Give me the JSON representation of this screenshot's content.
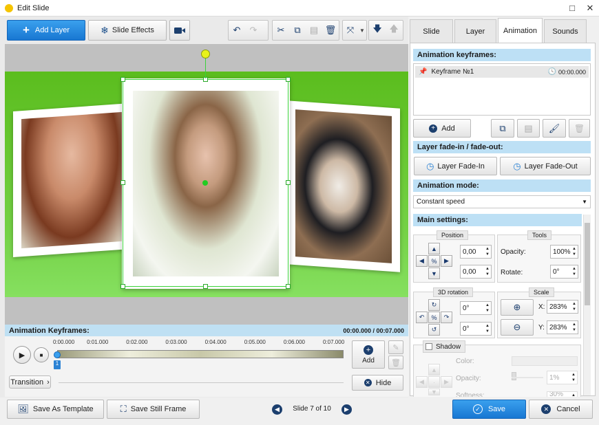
{
  "window": {
    "title": "Edit Slide",
    "minimize_icon": "□",
    "close_icon": "✕"
  },
  "toolbar": {
    "add_layer": "Add Layer",
    "slide_effects": "Slide Effects"
  },
  "timeline": {
    "title": "Animation Keyframes:",
    "time": "00:00.000 / 00:07.000",
    "ticks": [
      "0:00.000",
      "0:01.000",
      "0:02.000",
      "0:03.000",
      "0:04.000",
      "0:05.000",
      "0:06.000",
      "0:07.000"
    ],
    "marker": "1",
    "add": "Add",
    "hide": "Hide",
    "transition": "Transition"
  },
  "footer": {
    "save_template": "Save As Template",
    "save_still": "Save Still Frame",
    "slide_counter": "Slide 7 of 10",
    "save": "Save",
    "cancel": "Cancel"
  },
  "tabs": [
    "Slide",
    "Layer",
    "Animation",
    "Sounds"
  ],
  "animation": {
    "keyframes_title": "Animation keyframes:",
    "keyframe_name": "Keyframe №1",
    "keyframe_time": "00:00.000",
    "add": "Add",
    "fade_title": "Layer fade-in / fade-out:",
    "fade_in": "Layer Fade-In",
    "fade_out": "Layer Fade-Out",
    "mode_title": "Animation mode:",
    "mode_value": "Constant speed",
    "main_title": "Main settings:",
    "position_label": "Position",
    "pos_x": "0,00",
    "pos_y": "0,00",
    "tools_label": "Tools",
    "opacity_label": "Opacity:",
    "opacity": "100%",
    "rotate_label": "Rotate:",
    "rotate": "0°",
    "rot3d_label": "3D rotation",
    "rot3d_x": "0°",
    "rot3d_y": "0°",
    "scale_label": "Scale",
    "scale_x_label": "X:",
    "scale_x": "283%",
    "scale_y_label": "Y:",
    "scale_y": "283%",
    "shadow_label": "Shadow",
    "color_label": "Color:",
    "shadow_opacity_label": "Opacity:",
    "shadow_opacity": "1%",
    "softness_label": "Softness:",
    "softness": "30%"
  }
}
